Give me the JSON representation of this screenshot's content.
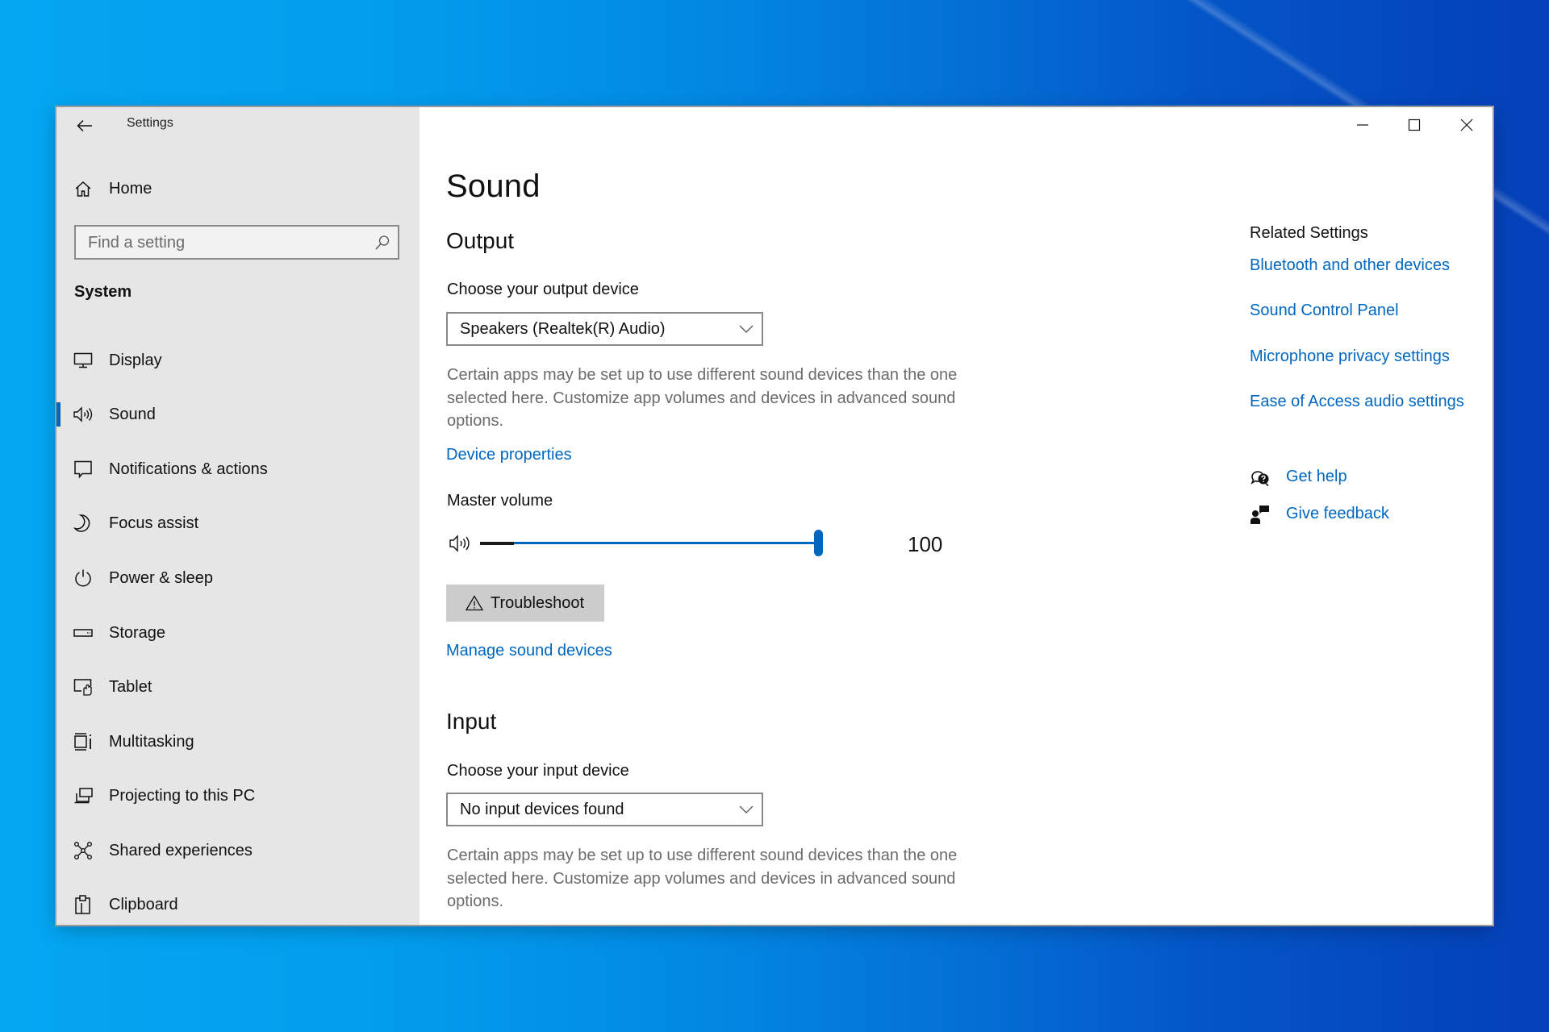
{
  "window": {
    "title": "Settings",
    "controls": {
      "minimize": "minimize-icon",
      "maximize": "maximize-icon",
      "close": "close-icon"
    }
  },
  "sidebar": {
    "back_icon": "back-arrow-icon",
    "home": {
      "label": "Home",
      "icon": "home-icon"
    },
    "search": {
      "placeholder": "Find a setting",
      "value": "",
      "icon": "search-icon"
    },
    "section": "System",
    "items": [
      {
        "label": "Display",
        "icon": "display-icon",
        "active": false
      },
      {
        "label": "Sound",
        "icon": "speaker-icon",
        "active": true
      },
      {
        "label": "Notifications & actions",
        "icon": "notification-icon",
        "active": false
      },
      {
        "label": "Focus assist",
        "icon": "moon-icon",
        "active": false
      },
      {
        "label": "Power & sleep",
        "icon": "power-icon",
        "active": false
      },
      {
        "label": "Storage",
        "icon": "storage-icon",
        "active": false
      },
      {
        "label": "Tablet",
        "icon": "tablet-icon",
        "active": false
      },
      {
        "label": "Multitasking",
        "icon": "multitasking-icon",
        "active": false
      },
      {
        "label": "Projecting to this PC",
        "icon": "projecting-icon",
        "active": false
      },
      {
        "label": "Shared experiences",
        "icon": "shared-experiences-icon",
        "active": false
      },
      {
        "label": "Clipboard",
        "icon": "clipboard-icon",
        "active": false
      }
    ]
  },
  "main": {
    "title": "Sound",
    "output": {
      "heading": "Output",
      "device_label": "Choose your output device",
      "device_value": "Speakers (Realtek(R) Audio)",
      "description": "Certain apps may be set up to use different sound devices than the one selected here. Customize app volumes and devices in advanced sound options.",
      "device_properties_link": "Device properties",
      "master_volume_label": "Master volume",
      "master_volume_value": "100",
      "master_volume_percent": 100,
      "output_level_percent": 10,
      "troubleshoot_button": "Troubleshoot",
      "manage_link": "Manage sound devices"
    },
    "input": {
      "heading": "Input",
      "device_label": "Choose your input device",
      "device_value": "No input devices found",
      "description": "Certain apps may be set up to use different sound devices than the one selected here. Customize app volumes and devices in advanced sound options."
    }
  },
  "related": {
    "title": "Related Settings",
    "links": [
      "Bluetooth and other devices",
      "Sound Control Panel",
      "Microphone privacy settings",
      "Ease of Access audio settings"
    ],
    "help": [
      {
        "label": "Get help",
        "icon": "get-help-icon"
      },
      {
        "label": "Give feedback",
        "icon": "give-feedback-icon"
      }
    ]
  },
  "colors": {
    "accent": "#0067c0",
    "sidebar_bg": "#e6e6e6",
    "desktop_left": "#04a6f2",
    "desktop_right": "#0440b8"
  }
}
